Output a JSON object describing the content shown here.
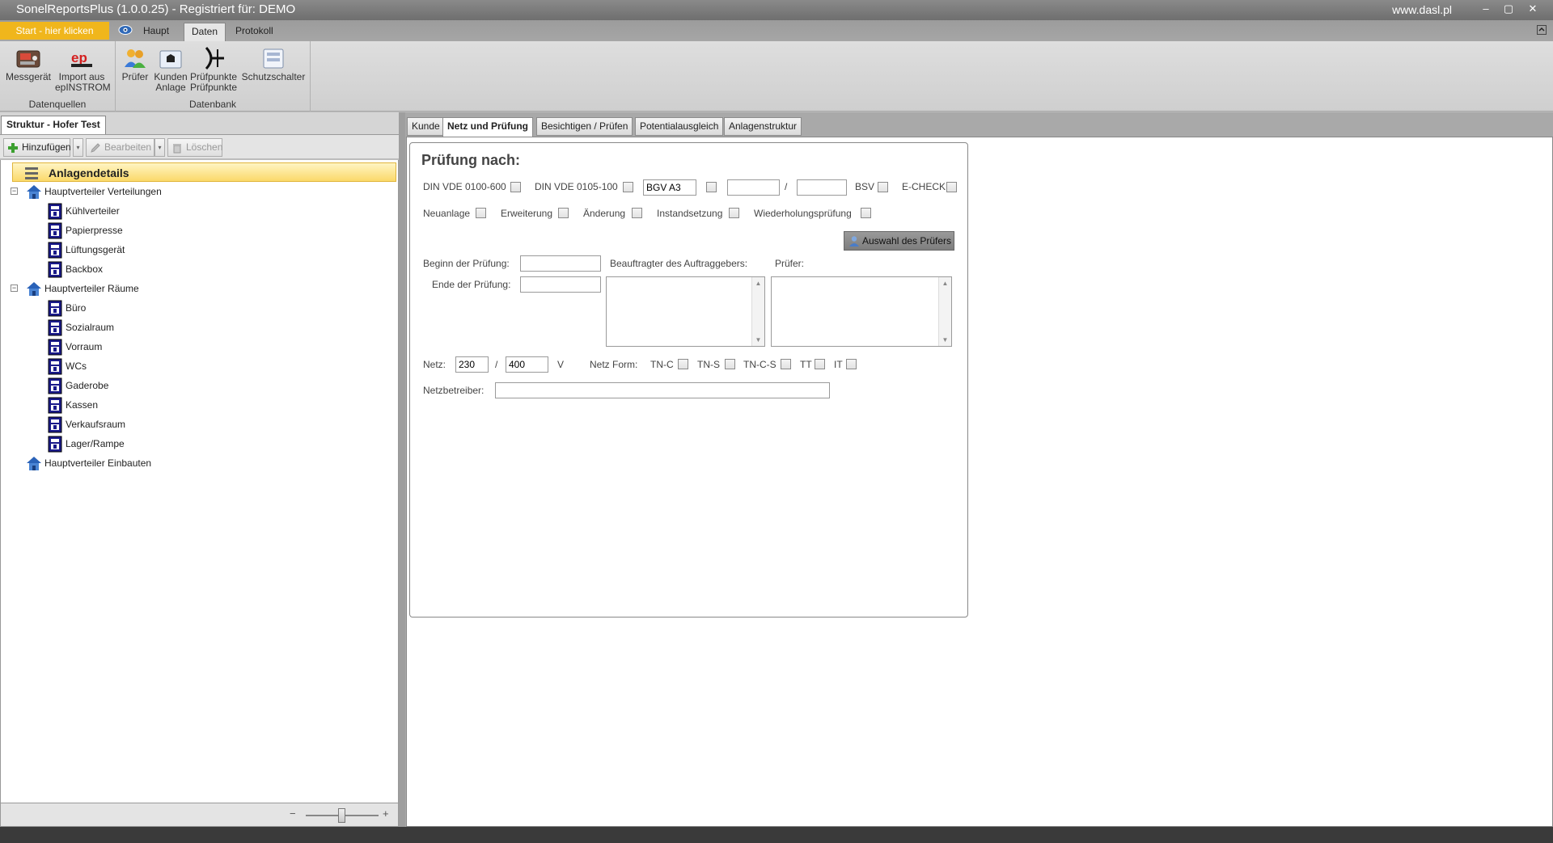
{
  "window": {
    "title": "SonelReportsPlus (1.0.0.25) - Registriert für: DEMO",
    "url": "www.dasl.pl",
    "controls": [
      "–",
      "▢",
      "✕"
    ]
  },
  "ribbon": {
    "start_label": "Start - hier klicken",
    "tabs": [
      {
        "label": "Haupt",
        "active": false
      },
      {
        "label": "Daten",
        "active": true
      },
      {
        "label": "Protokoll",
        "active": false
      }
    ],
    "groups": [
      {
        "label": "Datenquellen",
        "buttons": [
          {
            "label": "Messgerät",
            "icon": "meter-device-icon"
          },
          {
            "label": "Import aus epINSTROM",
            "icon": "ep-instrom-icon"
          }
        ]
      },
      {
        "label": "Datenbank",
        "buttons": [
          {
            "label": "Prüfer",
            "icon": "users-icon"
          },
          {
            "label": "Kunden Anlage",
            "icon": "customer-folder-icon"
          },
          {
            "label": "Prüfpunkte Prüfpunkte",
            "icon": "test-point-icon"
          },
          {
            "label": "Schutzschalter",
            "icon": "circuit-breaker-icon"
          }
        ]
      }
    ]
  },
  "left_panel": {
    "tab_label": "Struktur - Hofer Test",
    "toolbar": {
      "add": "Hinzufügen",
      "edit": "Bearbeiten",
      "delete": "Löschen"
    },
    "tree": [
      {
        "label": "Anlagendetails",
        "level": 0,
        "type": "root"
      },
      {
        "label": "Hauptverteiler Verteilungen",
        "level": 1,
        "type": "house",
        "expander": "−"
      },
      {
        "label": "Kühlverteiler",
        "level": 2,
        "type": "panel"
      },
      {
        "label": "Papierpresse",
        "level": 2,
        "type": "panel"
      },
      {
        "label": "Lüftungsgerät",
        "level": 2,
        "type": "panel"
      },
      {
        "label": "Backbox",
        "level": 2,
        "type": "panel"
      },
      {
        "label": "Hauptverteiler Räume",
        "level": 1,
        "type": "house",
        "expander": "−"
      },
      {
        "label": "Büro",
        "level": 2,
        "type": "panel"
      },
      {
        "label": "Sozialraum",
        "level": 2,
        "type": "panel"
      },
      {
        "label": "Vorraum",
        "level": 2,
        "type": "panel"
      },
      {
        "label": "WCs",
        "level": 2,
        "type": "panel"
      },
      {
        "label": "Gaderobe",
        "level": 2,
        "type": "panel"
      },
      {
        "label": "Kassen",
        "level": 2,
        "type": "panel"
      },
      {
        "label": "Verkaufsraum",
        "level": 2,
        "type": "panel"
      },
      {
        "label": "Lager/Rampe",
        "level": 2,
        "type": "panel"
      },
      {
        "label": "Hauptverteiler Einbauten",
        "level": 1,
        "type": "house",
        "expander": ""
      }
    ]
  },
  "form_tabs": [
    {
      "label": "Kunde",
      "active": false
    },
    {
      "label": "Netz und Prüfung",
      "active": true
    },
    {
      "label": "Besichtigen / Prüfen",
      "active": false
    },
    {
      "label": "Potentialausgleich",
      "active": false
    },
    {
      "label": "Anlagenstruktur",
      "active": false
    }
  ],
  "form": {
    "heading": "Prüfung nach:",
    "norm_row": {
      "din_600": "DIN VDE 0100-600",
      "din_100": "DIN VDE 0105-100",
      "bgv_value": "BGV A3",
      "extra1_value": "",
      "slash": "/",
      "extra2_value": "",
      "bsv": "BSV",
      "echeck": "E-CHECK"
    },
    "type_row": {
      "neuanlage": "Neuanlage",
      "erweiterung": "Erweiterung",
      "aenderung": "Änderung",
      "instandsetzung": "Instandsetzung",
      "wiederholung": "Wiederholungsprüfung"
    },
    "auswahl_button": "Auswahl des Prüfers",
    "beginn_label": "Beginn der Prüfung:",
    "beginn_value": "",
    "ende_label": "Ende der Prüfung:",
    "ende_value": "",
    "beauftragter_label": "Beauftragter des Auftraggebers:",
    "pruefer_label": "Prüfer:",
    "netz": {
      "label": "Netz:",
      "value1": "230",
      "slash": "/",
      "value2": "400",
      "unit": "V",
      "form_label": "Netz Form:",
      "forms": [
        "TN-C",
        "TN-S",
        "TN-C-S",
        "TT",
        "IT"
      ]
    },
    "netzbetreiber_label": "Netzbetreiber:",
    "netzbetreiber_value": ""
  },
  "zoom": {
    "minus": "−",
    "plus": "+"
  }
}
